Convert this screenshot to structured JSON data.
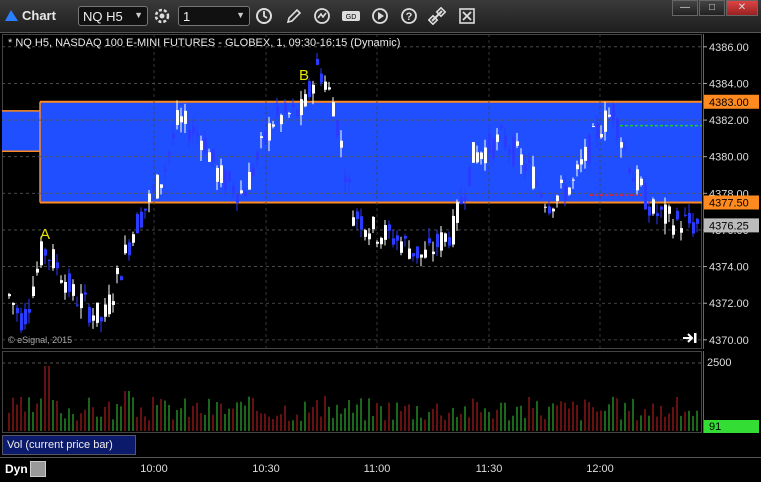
{
  "window": {
    "title": "Chart",
    "symbol": "NQ H5",
    "interval": "1",
    "buttons": [
      "minimize",
      "maximize",
      "close"
    ]
  },
  "toolbar": {
    "icons": [
      "settings-icon",
      "clock-icon",
      "pencil-icon",
      "cursor-icon",
      "zoom-icon",
      "play-icon",
      "help-icon",
      "link-icon",
      "close-doc-icon"
    ]
  },
  "chart": {
    "info": "* NQ H5, NASDAQ 100 E-MINI FUTURES - GLOBEX, 1, 09:30-16:15 (Dynamic)",
    "copyright": "© eSignal, 2015",
    "last_price": "4376.25",
    "band_high_tag": "4383.00",
    "band_low_tag": "4377.50",
    "volume_label": "Vol (current price bar)",
    "volume_last": "91",
    "dyn_label": "Dyn",
    "annotations": [
      "A",
      "B"
    ],
    "colors": {
      "band": "#1f4fff",
      "band_edge": "#ff8a1f",
      "up_bar": "#ffffff",
      "down_bar": "#2a3cff",
      "vol_up": "#33cc33",
      "vol_down": "#cc2222"
    }
  },
  "chart_data": {
    "type": "candlestick",
    "title": "NQ H5, NASDAQ 100 E-MINI FUTURES - GLOBEX, 1, 09:30-16:15 (Dynamic)",
    "price_ticks": [
      "4386.00",
      "4384.00",
      "4382.00",
      "4380.00",
      "4378.00",
      "4376.00",
      "4374.00",
      "4372.00",
      "4370.00"
    ],
    "ylim": [
      4369.5,
      4386.7
    ],
    "time_ticks": [
      "10:00",
      "10:30",
      "11:00",
      "11:30",
      "12:00"
    ],
    "volume_ticks": [
      "2500"
    ],
    "band": {
      "high": 4383.0,
      "low": 4377.5
    }
  }
}
